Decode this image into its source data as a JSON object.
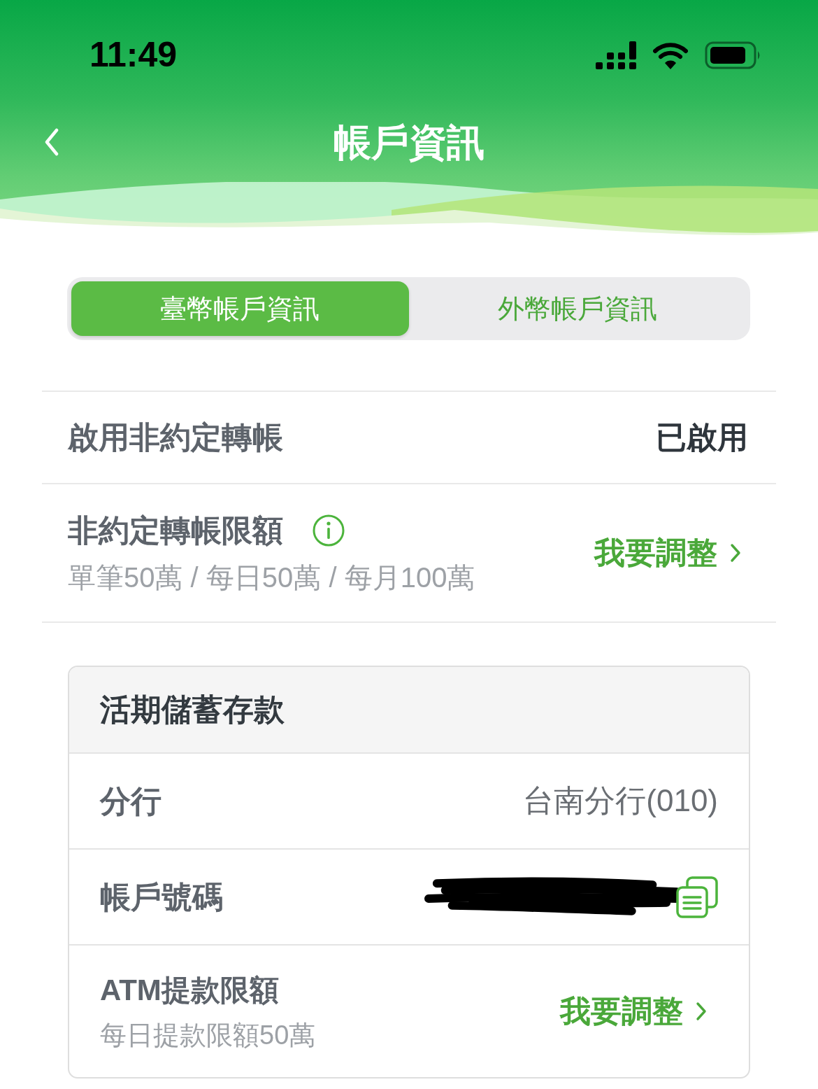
{
  "status_bar": {
    "time": "11:49"
  },
  "nav": {
    "title": "帳戶資訊"
  },
  "tabs": [
    {
      "label": "臺幣帳戶資訊",
      "selected": true
    },
    {
      "label": "外幣帳戶資訊",
      "selected": false
    }
  ],
  "settings": [
    {
      "kind": "status",
      "label": "啟用非約定轉帳",
      "value": "已啟用"
    },
    {
      "kind": "limit",
      "label": "非約定轉帳限額",
      "info": true,
      "detail": "單筆50萬 / 每日50萬 / 每月100萬",
      "action": "我要調整"
    }
  ],
  "account_card": {
    "title": "活期儲蓄存款",
    "rows": [
      {
        "kind": "value",
        "label": "分行",
        "value": "台南分行(010)"
      },
      {
        "kind": "masked",
        "label": "帳戶號碼"
      },
      {
        "kind": "limit",
        "label": "ATM提款限額",
        "detail": "每日提款限額50萬",
        "action": "我要調整"
      }
    ]
  }
}
